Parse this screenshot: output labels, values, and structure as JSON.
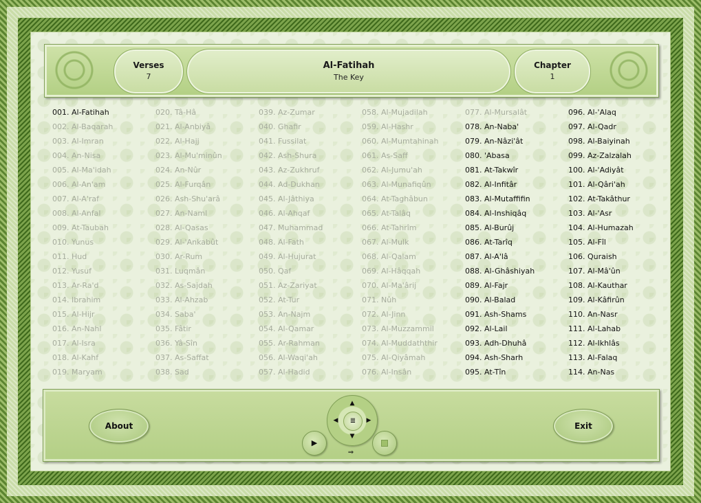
{
  "header": {
    "verses_label": "Verses",
    "verses_value": "7",
    "title": "Al-Fatihah",
    "subtitle": "The Key",
    "chapter_label": "Chapter",
    "chapter_value": "1"
  },
  "surahs": [
    [
      "001.",
      "Al-Fatihah",
      "active"
    ],
    [
      "002.",
      "Al-Baqarah",
      "dim"
    ],
    [
      "003.",
      "Al-Imran",
      "dim"
    ],
    [
      "004.",
      "An-Nisa",
      "dim"
    ],
    [
      "005.",
      "Al-Ma'idah",
      "dim"
    ],
    [
      "006.",
      "Al-An'am",
      "dim"
    ],
    [
      "007.",
      "Al-A'raf",
      "dim"
    ],
    [
      "008.",
      "Al-Anfal",
      "dim"
    ],
    [
      "009.",
      "At-Taubah",
      "dim"
    ],
    [
      "010.",
      "Yunus",
      "dim"
    ],
    [
      "011.",
      "Hud",
      "dim"
    ],
    [
      "012.",
      "Yusuf",
      "dim"
    ],
    [
      "013.",
      "Ar-Ra'd",
      "dim"
    ],
    [
      "014.",
      "Ibrahim",
      "dim"
    ],
    [
      "015.",
      "Al-Hijr",
      "dim"
    ],
    [
      "016.",
      "An-Nahl",
      "dim"
    ],
    [
      "017.",
      "Al-Isra",
      "dim"
    ],
    [
      "018.",
      "Al-Kahf",
      "dim"
    ],
    [
      "019.",
      "Maryam",
      "dim"
    ],
    [
      "020.",
      "Tâ-Hâ",
      "dim"
    ],
    [
      "021.",
      "Al-Anbiyâ",
      "dim"
    ],
    [
      "022.",
      "Al-Hajj",
      "dim"
    ],
    [
      "023.",
      "Al-Mu'minûn",
      "dim"
    ],
    [
      "024.",
      "An-Nûr",
      "dim"
    ],
    [
      "025.",
      "Al-Furqân",
      "dim"
    ],
    [
      "026.",
      "Ash-Shu'arâ",
      "dim"
    ],
    [
      "027.",
      "An-Naml",
      "dim"
    ],
    [
      "028.",
      "Al-Qasas",
      "dim"
    ],
    [
      "029.",
      "Al-'Ankabût",
      "dim"
    ],
    [
      "030.",
      "Ar-Rum",
      "dim"
    ],
    [
      "031.",
      "Luqmân",
      "dim"
    ],
    [
      "032.",
      "As-Sajdah",
      "dim"
    ],
    [
      "033.",
      "Al-Ahzab",
      "dim"
    ],
    [
      "034.",
      "Saba'",
      "dim"
    ],
    [
      "035.",
      "Fâtir",
      "dim"
    ],
    [
      "036.",
      "Yâ-Sîn",
      "dim"
    ],
    [
      "037.",
      "As-Saffat",
      "dim"
    ],
    [
      "038.",
      "Sad",
      "dim"
    ],
    [
      "039.",
      "Az-Zumar",
      "dim"
    ],
    [
      "040.",
      "Ghafir",
      "dim"
    ],
    [
      "041.",
      "Fussilat",
      "dim"
    ],
    [
      "042.",
      "Ash-Shura",
      "dim"
    ],
    [
      "043.",
      "Az-Zukhruf",
      "dim"
    ],
    [
      "044.",
      "Ad-Dukhan",
      "dim"
    ],
    [
      "045.",
      "Al-Jâthiya",
      "dim"
    ],
    [
      "046.",
      "Al-Ahqaf",
      "dim"
    ],
    [
      "047.",
      "Muhammad",
      "dim"
    ],
    [
      "048.",
      "Al-Fath",
      "dim"
    ],
    [
      "049.",
      "Al-Hujurat",
      "dim"
    ],
    [
      "050.",
      "Qaf",
      "dim"
    ],
    [
      "051.",
      "Az-Zariyat",
      "dim"
    ],
    [
      "052.",
      "At-Tur",
      "dim"
    ],
    [
      "053.",
      "An-Najm",
      "dim"
    ],
    [
      "054.",
      "Al-Qamar",
      "dim"
    ],
    [
      "055.",
      "Ar-Rahman",
      "dim"
    ],
    [
      "056.",
      "Al-Waqi'ah",
      "dim"
    ],
    [
      "057.",
      "Al-Hadid",
      "dim"
    ],
    [
      "058.",
      "Al-Mujadilah",
      "dim"
    ],
    [
      "059.",
      "Al-Hashr",
      "dim"
    ],
    [
      "060.",
      "Al-Mumtahinah",
      "dim"
    ],
    [
      "061.",
      "As-Saff",
      "dim"
    ],
    [
      "062.",
      "Al-Jumu'ah",
      "dim"
    ],
    [
      "063.",
      "Al-Munafiqûn",
      "dim"
    ],
    [
      "064.",
      "At-Taghâbun",
      "dim"
    ],
    [
      "065.",
      "At-Talâq",
      "dim"
    ],
    [
      "066.",
      "At-Tahrîm",
      "dim"
    ],
    [
      "067.",
      "Al-Mulk",
      "dim"
    ],
    [
      "068.",
      "Al-Qalam",
      "dim"
    ],
    [
      "069.",
      "Al-Hâqqah",
      "dim"
    ],
    [
      "070.",
      "Al-Ma'ârij",
      "dim"
    ],
    [
      "071.",
      "Nûh",
      "dim"
    ],
    [
      "072.",
      "Al-Jinn",
      "dim"
    ],
    [
      "073.",
      "Al-Muzzammil",
      "dim"
    ],
    [
      "074.",
      "Al-Muddaththir",
      "dim"
    ],
    [
      "075.",
      "Al-Qiyâmah",
      "dim"
    ],
    [
      "076.",
      "Al-Insân",
      "dim"
    ],
    [
      "077.",
      "Al-Mursalât",
      "dim"
    ],
    [
      "078.",
      "An-Naba'",
      "active"
    ],
    [
      "079.",
      "An-Nâzi'ât",
      "active"
    ],
    [
      "080.",
      "'Abasa",
      "active"
    ],
    [
      "081.",
      "At-Takwîr",
      "active"
    ],
    [
      "082.",
      "Al-Infitâr",
      "active"
    ],
    [
      "083.",
      "Al-Mutaffifin",
      "active"
    ],
    [
      "084.",
      "Al-Inshiqâq",
      "active"
    ],
    [
      "085.",
      "Al-Burûj",
      "active"
    ],
    [
      "086.",
      "At-Tarîq",
      "active"
    ],
    [
      "087.",
      "Al-A'lâ",
      "active"
    ],
    [
      "088.",
      "Al-Ghâshiyah",
      "active"
    ],
    [
      "089.",
      "Al-Fajr",
      "active"
    ],
    [
      "090.",
      "Al-Balad",
      "active"
    ],
    [
      "091.",
      "Ash-Shams",
      "active"
    ],
    [
      "092.",
      "Al-Lail",
      "active"
    ],
    [
      "093.",
      "Adh-Dhuhâ",
      "active"
    ],
    [
      "094.",
      "Ash-Sharh",
      "active"
    ],
    [
      "095.",
      "At-Tîn",
      "active"
    ],
    [
      "096.",
      "Al-'Alaq",
      "active"
    ],
    [
      "097.",
      "Al-Qadr",
      "active"
    ],
    [
      "098.",
      "Al-Baiyinah",
      "active"
    ],
    [
      "099.",
      "Az-Zalzalah",
      "active"
    ],
    [
      "100.",
      "Al-'Adiyât",
      "active"
    ],
    [
      "101.",
      "Al-Qâri'ah",
      "active"
    ],
    [
      "102.",
      "At-Takâthur",
      "active"
    ],
    [
      "103.",
      "Al-'Asr",
      "active"
    ],
    [
      "104.",
      "Al-Humazah",
      "active"
    ],
    [
      "105.",
      "Al-Fîl",
      "active"
    ],
    [
      "106.",
      "Quraish",
      "active"
    ],
    [
      "107.",
      "Al-Mâ'ûn",
      "active"
    ],
    [
      "108.",
      "Al-Kauthar",
      "active"
    ],
    [
      "109.",
      "Al-Kâfirûn",
      "active"
    ],
    [
      "110.",
      "An-Nasr",
      "active"
    ],
    [
      "111.",
      "Al-Lahab",
      "active"
    ],
    [
      "112.",
      "Al-Ikhlâs",
      "active"
    ],
    [
      "113.",
      "Al-Falaq",
      "active"
    ],
    [
      "114.",
      "An-Nas",
      "active"
    ]
  ],
  "footer": {
    "about_label": "About",
    "exit_label": "Exit",
    "nav_up": "▲",
    "nav_down": "▼",
    "nav_left": "◀",
    "nav_right": "▶",
    "nav_center": "≣",
    "play_icon": "▶",
    "next_icon": "⇒"
  },
  "colors": {
    "active_text": "#111111",
    "dim_text": "#a6ac9d",
    "panel_green": "#b8d28b",
    "frame_green": "#5b8430"
  }
}
